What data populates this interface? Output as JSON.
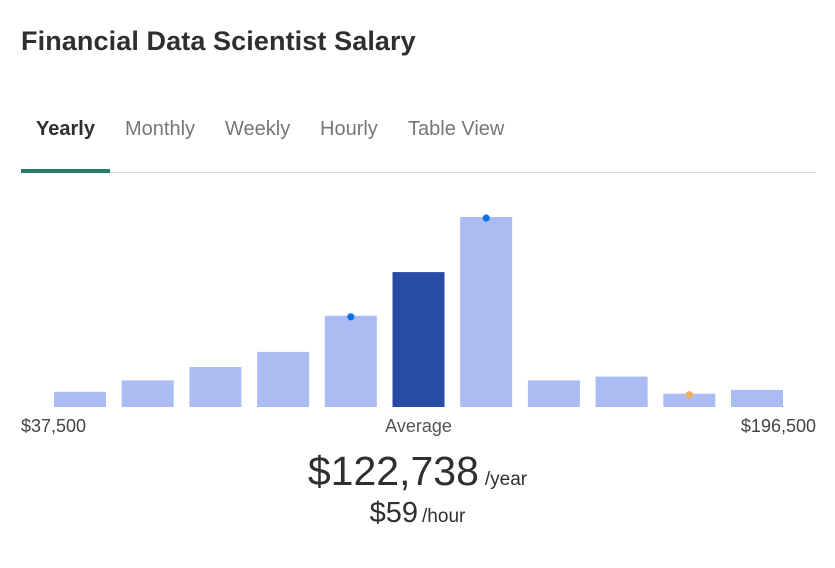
{
  "page": {
    "title": "Financial Data Scientist Salary"
  },
  "tabs": [
    {
      "label": "Yearly",
      "active": true
    },
    {
      "label": "Monthly",
      "active": false
    },
    {
      "label": "Weekly",
      "active": false
    },
    {
      "label": "Hourly",
      "active": false
    },
    {
      "label": "Table View",
      "active": false
    }
  ],
  "summary": {
    "average_label": "Average",
    "yearly_value": "$122,738",
    "yearly_unit": "/year",
    "hourly_value": "$59",
    "hourly_unit": "/hour"
  },
  "colors": {
    "tab_accent": "#247d65",
    "bar": "#aabcf2",
    "bar_highlight": "#284ba4",
    "marker_blue": "#0b73e4",
    "marker_orange": "#f7ab5c"
  },
  "chart_data": {
    "type": "bar",
    "title": "Financial Data Scientist Salary distribution",
    "xlabel": "",
    "ylabel": "",
    "x_min_label": "$37,500",
    "x_max_label": "$196,500",
    "x_range": [
      37500,
      196500
    ],
    "value_units": "relative frequency (tallest bar = 100)",
    "ylim": [
      0,
      100
    ],
    "grid": false,
    "legend": "none",
    "bins": 11,
    "values": [
      8,
      14,
      21,
      29,
      48,
      71,
      100,
      14,
      16,
      7,
      9
    ],
    "highlight_index": 5,
    "highlight_label": "Average",
    "markers": [
      {
        "bin": 4,
        "color": "blue"
      },
      {
        "bin": 6,
        "color": "blue"
      },
      {
        "bin": 9,
        "color": "orange"
      }
    ]
  }
}
